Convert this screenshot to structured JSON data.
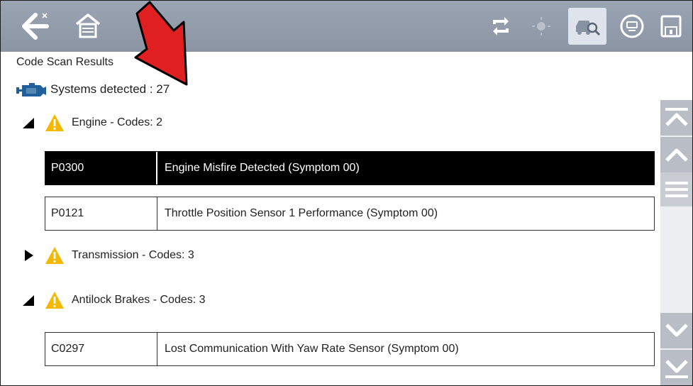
{
  "toolbar": {
    "buttons": [
      {
        "name": "back-icon",
        "icon": "left-arrow-with-x"
      },
      {
        "name": "home-icon",
        "icon": "home"
      },
      {
        "name": "sync-icon",
        "icon": "flip-arrows"
      },
      {
        "name": "brightness-icon",
        "icon": "brightness"
      },
      {
        "name": "vehicle-scan-icon",
        "icon": "car-magnifier"
      },
      {
        "name": "print-icon",
        "icon": "printer-circle"
      },
      {
        "name": "save-icon",
        "icon": "floppy-disk"
      }
    ],
    "active_color": "#dfe4ec"
  },
  "page": {
    "title": "Code Scan Results",
    "systems_detected": "Systems detected : 27"
  },
  "groups": [
    {
      "label": "Engine - Codes: 2",
      "expanded": true,
      "codes": [
        {
          "code": "P0300",
          "description": "Engine Misfire Detected (Symptom 00)",
          "selected": true
        },
        {
          "code": "P0121",
          "description": "Throttle Position Sensor 1 Performance (Symptom 00)",
          "selected": false
        }
      ]
    },
    {
      "label": "Transmission - Codes: 3",
      "expanded": false,
      "codes": []
    },
    {
      "label": "Antilock Brakes - Codes: 3",
      "expanded": true,
      "codes": [
        {
          "code": "C0297",
          "description": "Lost Communication With Yaw Rate Sensor (Symptom 00)",
          "selected": false
        }
      ]
    }
  ],
  "colors": {
    "toolbar": "#8f99a8",
    "warning": "#f5b800",
    "engine_icon": "#1f5f9c",
    "annotation_arrow": "#e02020",
    "selected_row": "#000000"
  }
}
